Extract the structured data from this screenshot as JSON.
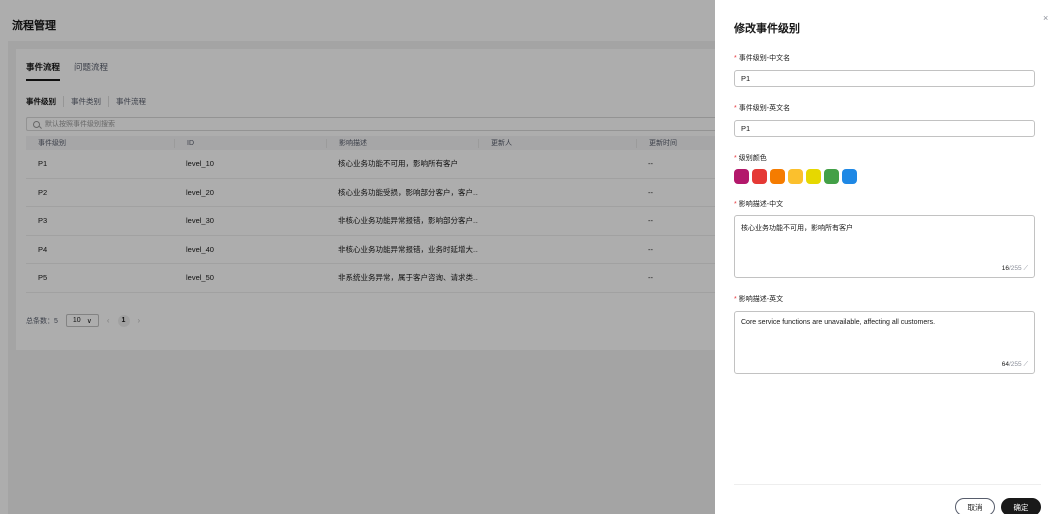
{
  "page": {
    "title": "流程管理"
  },
  "tabs": [
    "事件流程",
    "问题流程"
  ],
  "subtabs": [
    "事件级别",
    "事件类别",
    "事件流程"
  ],
  "search": {
    "placeholder": "默认按照事件级别搜索"
  },
  "table": {
    "headers": [
      "事件级别",
      "ID",
      "影响描述",
      "更新人",
      "更新时间"
    ],
    "rows": [
      {
        "level": "P1",
        "id": "level_10",
        "desc": "核心业务功能不可用，影响所有客户",
        "updater": "",
        "time": "--"
      },
      {
        "level": "P2",
        "id": "level_20",
        "desc": "核心业务功能受损，影响部分客户，客户...",
        "updater": "",
        "time": "--"
      },
      {
        "level": "P3",
        "id": "level_30",
        "desc": "非核心业务功能异常报错，影响部分客户...",
        "updater": "",
        "time": "--"
      },
      {
        "level": "P4",
        "id": "level_40",
        "desc": "非核心业务功能异常报错，业务时延增大...",
        "updater": "",
        "time": "--"
      },
      {
        "level": "P5",
        "id": "level_50",
        "desc": "非系统业务异常，属于客户咨询、请求类...",
        "updater": "",
        "time": "--"
      }
    ]
  },
  "pager": {
    "total": "总条数：5",
    "page_size": "10",
    "current": "1"
  },
  "drawer": {
    "title": "修改事件级别",
    "close": "×",
    "name_cn": {
      "label": "事件级别-中文名",
      "value": "P1"
    },
    "name_en": {
      "label": "事件级别-英文名",
      "value": "P1"
    },
    "color": {
      "label": "级别颜色",
      "swatches": [
        "#b3186b",
        "#e53935",
        "#f57c00",
        "#fbc02d",
        "#e6d800",
        "#43a047",
        "#1e88e5"
      ]
    },
    "desc_cn": {
      "label": "影响描述-中文",
      "value": "核心业务功能不可用，影响所有客户",
      "count": "16",
      "max": "/255"
    },
    "desc_en": {
      "label": "影响描述-英文",
      "value": "Core service functions are unavailable, affecting all customers.",
      "count": "64",
      "max": "/255"
    },
    "cancel": "取消",
    "confirm": "确定"
  }
}
